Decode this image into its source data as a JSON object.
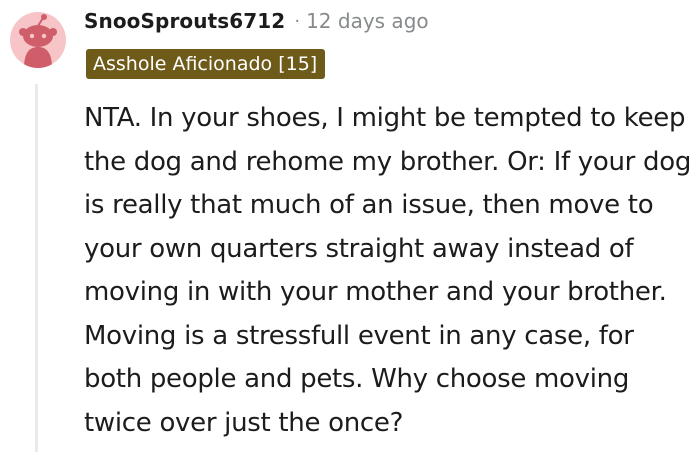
{
  "comment": {
    "username": "SnooSprouts6712",
    "separator": "·",
    "timestamp": "12 days ago",
    "flair": "Asshole Aficionado [15]",
    "body": "NTA. In your shoes, I might be tempted to keep the dog and rehome my brother. Or: If your dog is really that much of an issue, then move to your own quarters straight away instead of moving in with your mother and your brother. Moving is a stressfull event in any case, for both people and pets. Why choose moving twice over just the once?",
    "avatar_icon": "snoo-avatar-icon"
  },
  "colors": {
    "avatar_bg": "#f7c4c7",
    "flair_bg": "#6e5a19",
    "meta_text": "#878a8c",
    "thread_line": "#e9eaeb"
  }
}
